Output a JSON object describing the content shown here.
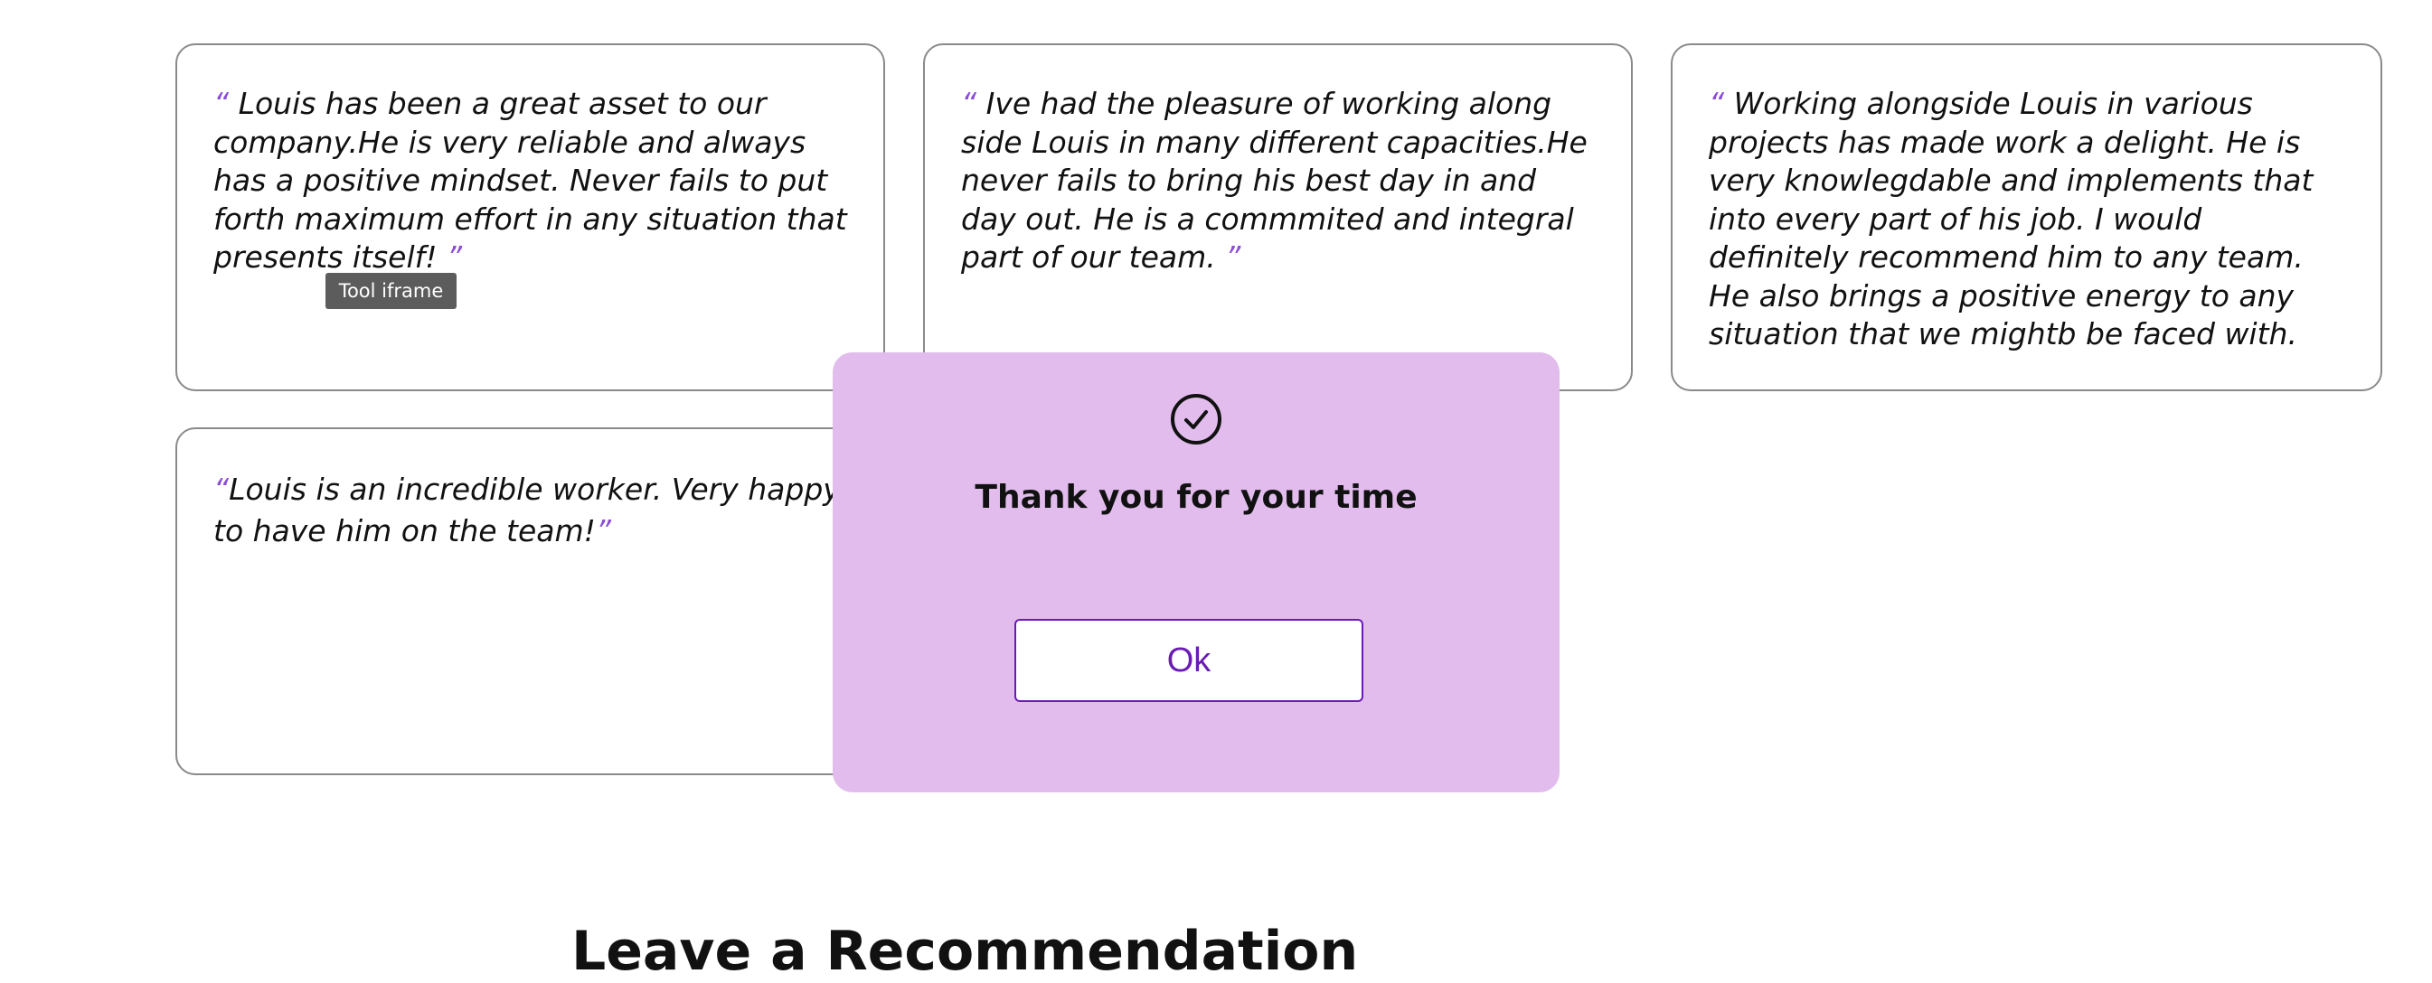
{
  "testimonials": [
    {
      "open_quote": "“",
      "text": " Louis has been a great asset to our company.He is very reliable and always has a positive mindset. Never fails to put forth maximum effort in any situation that presents itself! ",
      "close_quote": "”"
    },
    {
      "open_quote": "“",
      "text": " Ive had the pleasure of working along side Louis in many different capacities.He never fails to bring his best day in and day out. He is a commmited and integral part of our team. ",
      "close_quote": "”"
    },
    {
      "open_quote": "“",
      "text": " Working alongside Louis in various projects has made work a delight. He is very knowlegdable and implements that into every part of his job. I would definitely recommend him to any team. He also brings a positive energy to any situation that we mightb be faced with.",
      "close_quote": ""
    },
    {
      "open_quote": "“",
      "text": "Louis is an incredible worker. Very happy to have him on the team!",
      "close_quote": "”"
    }
  ],
  "tooltip": {
    "label": "Tool iframe"
  },
  "modal": {
    "icon": "check-circle-icon",
    "title": "Thank you for your time",
    "ok_label": "Ok"
  },
  "section": {
    "title": "Leave a Recommendation"
  },
  "colors": {
    "modal_background": "#e1bcec",
    "accent": "#6a1bb5",
    "quote_mark": "#8a4ed6"
  }
}
